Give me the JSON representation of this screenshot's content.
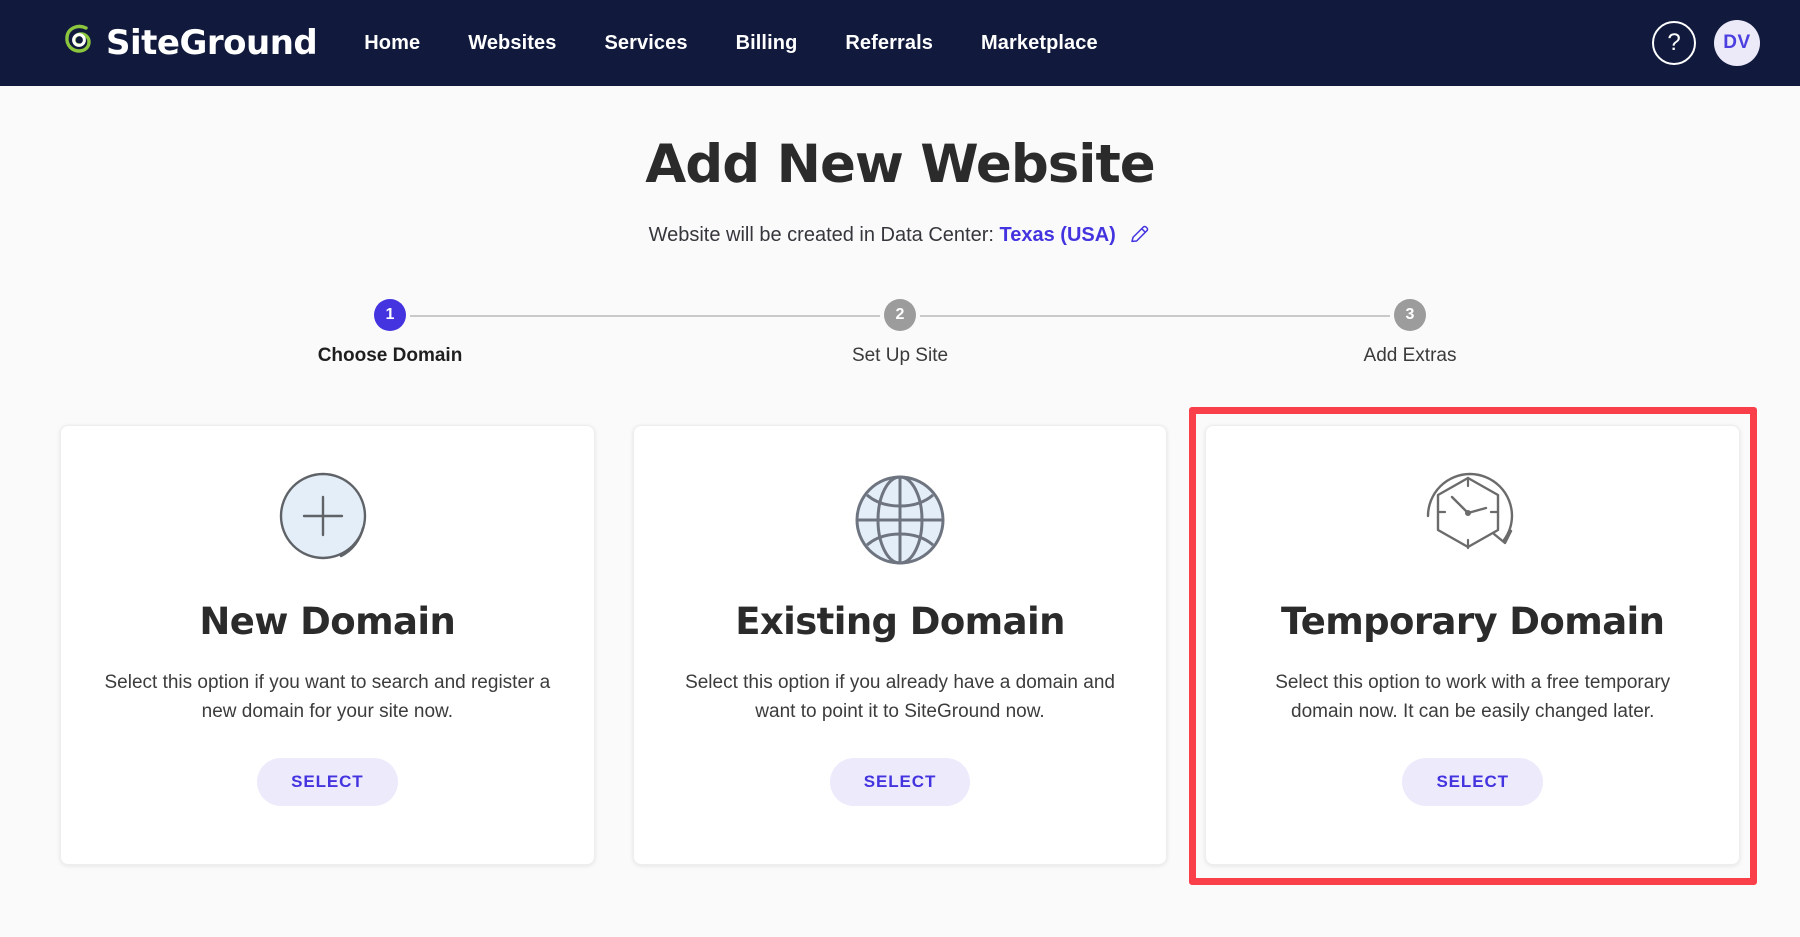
{
  "navbar": {
    "logo_text": "SiteGround",
    "logo_icon": "siteground-swirl-icon",
    "links": [
      {
        "label": "Home"
      },
      {
        "label": "Websites"
      },
      {
        "label": "Services"
      },
      {
        "label": "Billing"
      },
      {
        "label": "Referrals"
      },
      {
        "label": "Marketplace"
      }
    ],
    "help_label": "?",
    "help_icon": "question-mark-circle-icon",
    "avatar_initials": "DV",
    "brand_bg": "#111a3d",
    "logo_green": "#8cc63e"
  },
  "header": {
    "title": "Add New Website",
    "subtitle_prefix": "Website will be created in Data Center:",
    "data_center": "Texas (USA)",
    "edit_icon": "pencil-icon"
  },
  "stepper": {
    "steps": [
      {
        "number": "1",
        "label": "Choose Domain",
        "state": "active"
      },
      {
        "number": "2",
        "label": "Set Up Site",
        "state": "inactive"
      },
      {
        "number": "3",
        "label": "Add Extras",
        "state": "inactive"
      }
    ],
    "active_color": "#4434e0",
    "inactive_color": "#9c9c9c"
  },
  "cards": [
    {
      "icon": "plus-circle-icon",
      "title": "New Domain",
      "description": "Select this option if you want to search and register a new domain for your site now.",
      "button_label": "SELECT",
      "highlighted": false
    },
    {
      "icon": "globe-icon",
      "title": "Existing Domain",
      "description": "Select this option if you already have a domain and want to point it to SiteGround now.",
      "button_label": "SELECT",
      "highlighted": false
    },
    {
      "icon": "temporary-clock-icon",
      "title": "Temporary Domain",
      "description": "Select this option to work with a free temporary domain now. It can be easily changed later.",
      "button_label": "SELECT",
      "highlighted": true
    }
  ],
  "annotation": {
    "highlight_color": "#f9404a",
    "target": "temporary-domain-card"
  }
}
